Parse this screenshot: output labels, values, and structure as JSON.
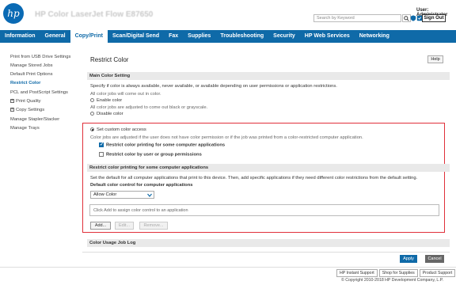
{
  "header": {
    "product_name": "HP Color LaserJet Flow E87650",
    "search_placeholder": "Search by Keyword",
    "user_label": "User: Administrator",
    "sign_out": "Sign Out"
  },
  "nav": [
    "Information",
    "General",
    "Copy/Print",
    "Scan/Digital Send",
    "Fax",
    "Supplies",
    "Troubleshooting",
    "Security",
    "HP Web Services",
    "Networking"
  ],
  "sidebar": {
    "items": [
      "Print from USB Drive Settings",
      "Manage Stored Jobs",
      "Default Print Options",
      "Restrict Color",
      "PCL and PostScript Settings",
      "Print Quality",
      "Copy Settings",
      "Manage Stapler/Stacker",
      "Manage Trays"
    ]
  },
  "main": {
    "title": "Restrict Color",
    "help": "Help",
    "section_main": "Main Color Setting",
    "intro": "Specify if color is always available, never available, or available depending on user permissions or application restrictions.",
    "enable_desc": "All color jobs will come out in color.",
    "enable_label": "Enable color",
    "disable_desc": "All color jobs are adjusted to come out black or grayscale.",
    "disable_label": "Disable color",
    "custom_label": "Set custom color access",
    "custom_desc": "Color jobs are adjusted if the user does not have color permission or if the job was printed from a color-restricted computer application.",
    "restrict_apps_label": "Restrict color printing for some computer applications",
    "restrict_users_label": "Restrict color by user or group permissions",
    "section_apps": "Restrict color printing for some computer applications",
    "apps_desc": "Set the default for all computer applications that print to this device. Then, add specific applications if they need different color restrictions from the default setting.",
    "default_control_label": "Default color control for computer applications",
    "default_control_value": "Allow Color",
    "list_hint": "Click Add to assign color control to an application",
    "add": "Add...",
    "edit": "Edit...",
    "remove": "Remove...",
    "section_log": "Color Usage Job Log",
    "apply": "Apply",
    "cancel": "Cancel"
  },
  "footer": {
    "links": [
      "HP Instant Support",
      "Shop for Supplies",
      "Product Support"
    ],
    "copyright": "© Copyright 2010-2018 HP Development Company, L.P."
  },
  "colors": {
    "brand": "#0f6aa8",
    "highlight_box": "#e0303a"
  }
}
